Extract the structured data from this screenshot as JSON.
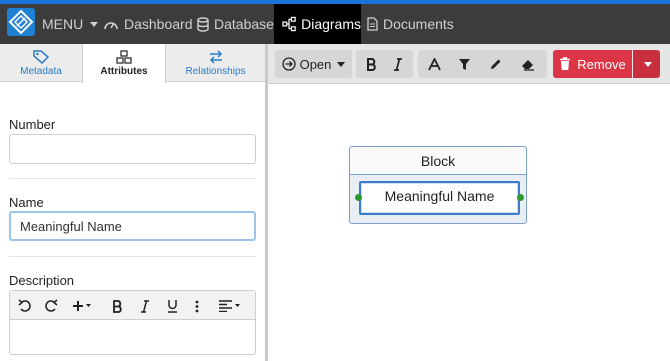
{
  "topbar": {
    "menu_label": "MENU",
    "nav": [
      {
        "label": "Dashboard",
        "icon": "dashboard-icon"
      },
      {
        "label": "Database",
        "icon": "database-icon"
      },
      {
        "label": "Diagrams",
        "icon": "diagram-icon",
        "active": true
      },
      {
        "label": "Documents",
        "icon": "document-icon"
      }
    ]
  },
  "sidebar": {
    "tabs": [
      {
        "label": "Metadata",
        "icon": "tag-icon"
      },
      {
        "label": "Attributes",
        "icon": "attributes-icon",
        "active": true
      },
      {
        "label": "Relationships",
        "icon": "swap-arrows-icon"
      }
    ],
    "fields": {
      "number": {
        "label": "Number",
        "value": ""
      },
      "name": {
        "label": "Name",
        "value": "Meaningful Name"
      },
      "description": {
        "label": "Description",
        "value": ""
      }
    }
  },
  "toolbar": {
    "open_label": "Open",
    "remove_label": "Remove"
  },
  "canvas": {
    "block": {
      "title": "Block",
      "name": "Meaningful Name"
    }
  },
  "colors": {
    "accent": "#1a73d6",
    "topbar": "#3c3c3c",
    "remove": "#dc3545",
    "port": "#2e9a2e"
  }
}
